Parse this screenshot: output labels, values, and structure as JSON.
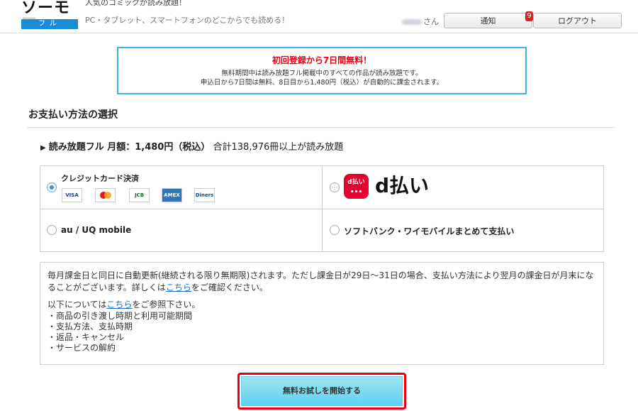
{
  "header": {
    "logo_text": "ソーモア",
    "logo_sub": "フル",
    "tagline1": "人気のコミックが読み放題！",
    "tagline2": "PC・タブレット、スマートフォンのどこからでも読める！",
    "user_suffix": "さん",
    "notice_label": "通知",
    "notice_count": "9",
    "logout_label": "ログアウト"
  },
  "promo": {
    "title": "初回登録から7日間無料！",
    "line1": "無料期間中は読み放題フル掲載中のすべての作品が読み放題です。",
    "line2": "申込日から7日間は無料、8日目から1,480円（税込）が自動的に課金されます。"
  },
  "section_title": "お支払い方法の選択",
  "plan": {
    "arrow": "▶",
    "bold_text": "読み放題フル 月額：1,480円（税込）",
    "rest_text": "合計138,976冊以上が読み放題"
  },
  "payment_options": {
    "credit": {
      "label": "クレジットカード決済",
      "selected": true,
      "cards": [
        "VISA",
        "MasterCard",
        "JCB",
        "AMEX",
        "Diners"
      ]
    },
    "dpay": {
      "icon_text": "d払い",
      "logo_text": "d払い",
      "selected": false
    },
    "au": {
      "label": "au / UQ mobile",
      "selected": false
    },
    "softbank": {
      "label": "ソフトバンク・ワイモバイルまとめて支払い",
      "selected": false
    }
  },
  "notice": {
    "p1_before": "毎月課金日と同日に自動更新(継続される限り無期限)されます。ただし課金日が29日～31日の場合、支払い方法により翌月の課金日が月末になることがございます。詳しくは",
    "p1_link": "こちら",
    "p1_after": "をご確認ください。",
    "p2_before": "以下については",
    "p2_link": "こちら",
    "p2_after": "をご参照下さい。",
    "items": [
      "・商品の引き渡し時期と利用可能期間",
      "・支払方法、支払時期",
      "・返品・キャンセル",
      "・サービスの解約"
    ]
  },
  "cta_label": "無料お試しを開始する",
  "colors": {
    "accent_red": "#e60012",
    "promo_border": "#3db3e3",
    "cta_bg": "#5ed0ee",
    "link": "#1a6ec7"
  }
}
